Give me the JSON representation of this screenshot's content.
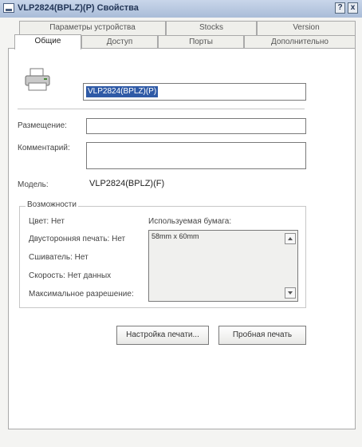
{
  "window": {
    "title": "VLP2824(BPLZ)(P) Свойства",
    "help_label": "?",
    "close_label": "x"
  },
  "tabs_top": [
    "Параметры устройства",
    "Stocks",
    "Version"
  ],
  "tabs_bottom": [
    "Общие",
    "Доступ",
    "Порты",
    "Дополнительно"
  ],
  "active_tab": "Общие",
  "general": {
    "printer_name": "VLP2824(BPLZ)(P)",
    "location_label": "Размещение:",
    "location_value": "",
    "comment_label": "Комментарий:",
    "comment_value": "",
    "model_label": "Модель:",
    "model_value": "VLP2824(BPLZ)(F)"
  },
  "features": {
    "title": "Возможности",
    "color": "Цвет: Нет",
    "duplex": "Двусторонняя печать: Нет",
    "staple": "Сшиватель: Нет",
    "speed": "Скорость: Нет данных",
    "max_resolution": "Максимальное разрешение:",
    "paper_label": "Используемая бумага:",
    "paper_items": [
      "58mm x 60mm"
    ]
  },
  "buttons": {
    "preferences": "Настройка печати...",
    "test_page": "Пробная печать"
  }
}
